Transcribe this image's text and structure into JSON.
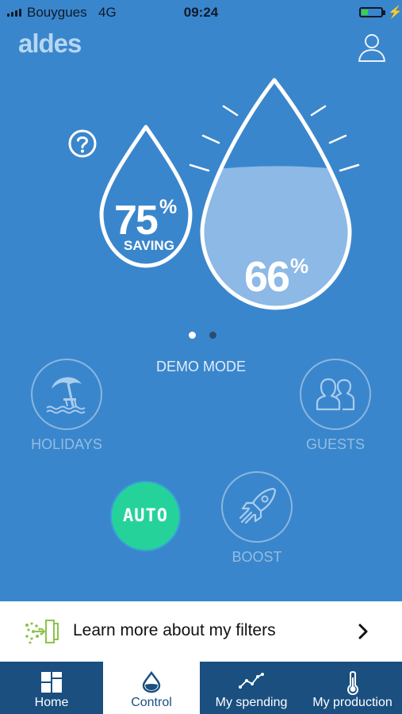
{
  "status_bar": {
    "carrier": "Bouygues",
    "network": "4G",
    "time": "09:24"
  },
  "header": {
    "logo": "aldes"
  },
  "indicators": {
    "saving": {
      "value": "75",
      "unit": "%",
      "label": "SAVING"
    },
    "level": {
      "value": "66",
      "unit": "%",
      "fill_fraction": 0.66
    }
  },
  "carousel": {
    "pages": 2,
    "active_index": 0
  },
  "mode_text": "DEMO MODE",
  "modes": {
    "holidays": {
      "label": "HOLIDAYS"
    },
    "guests": {
      "label": "GUESTS"
    },
    "auto": {
      "label": "AUTO"
    },
    "boost": {
      "label": "BOOST"
    }
  },
  "filters_banner": {
    "text": "Learn more about my filters"
  },
  "tabs": [
    {
      "label": "Home",
      "icon": "home-grid-icon",
      "selected": false
    },
    {
      "label": "Control",
      "icon": "drop-icon",
      "selected": true
    },
    {
      "label": "My spending",
      "icon": "chart-line-icon",
      "selected": false
    },
    {
      "label": "My production",
      "icon": "thermometer-icon",
      "selected": false
    }
  ],
  "colors": {
    "background": "#3a86cc",
    "auto_active": "#25d39a",
    "tab_bar": "#1a4f80",
    "filter_icon": "#8bc34a"
  }
}
